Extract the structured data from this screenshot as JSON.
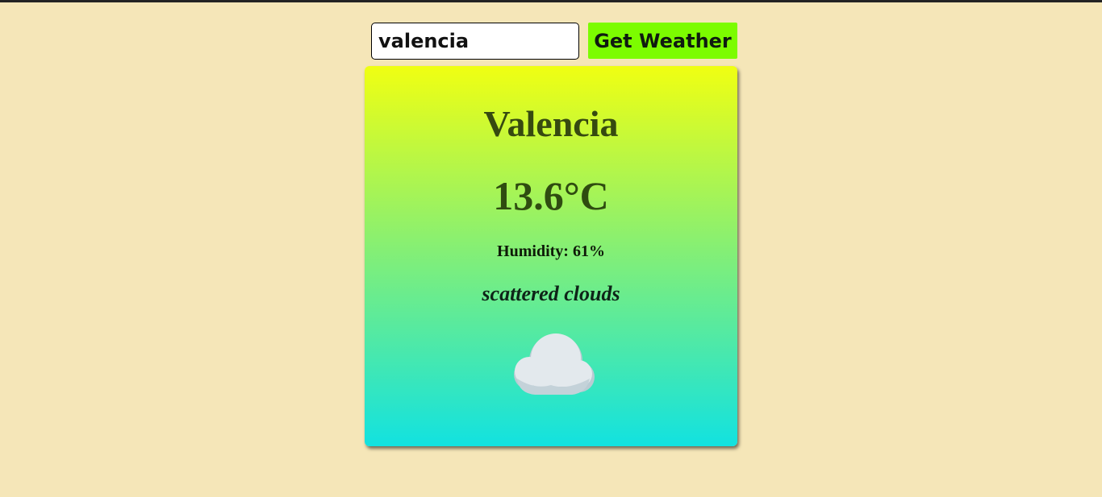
{
  "search": {
    "value": "valencia",
    "button_label": "Get Weather"
  },
  "weather": {
    "city": "Valencia",
    "temperature": "13.6°C",
    "humidity_label": "Humidity: 61%",
    "description": "scattered clouds",
    "icon": "cloud-icon"
  },
  "colors": {
    "page_background": "#f5e6b8",
    "button_background": "#7cfc00",
    "card_gradient_top": "#f0ff12",
    "card_gradient_bottom": "#12e2e0"
  }
}
